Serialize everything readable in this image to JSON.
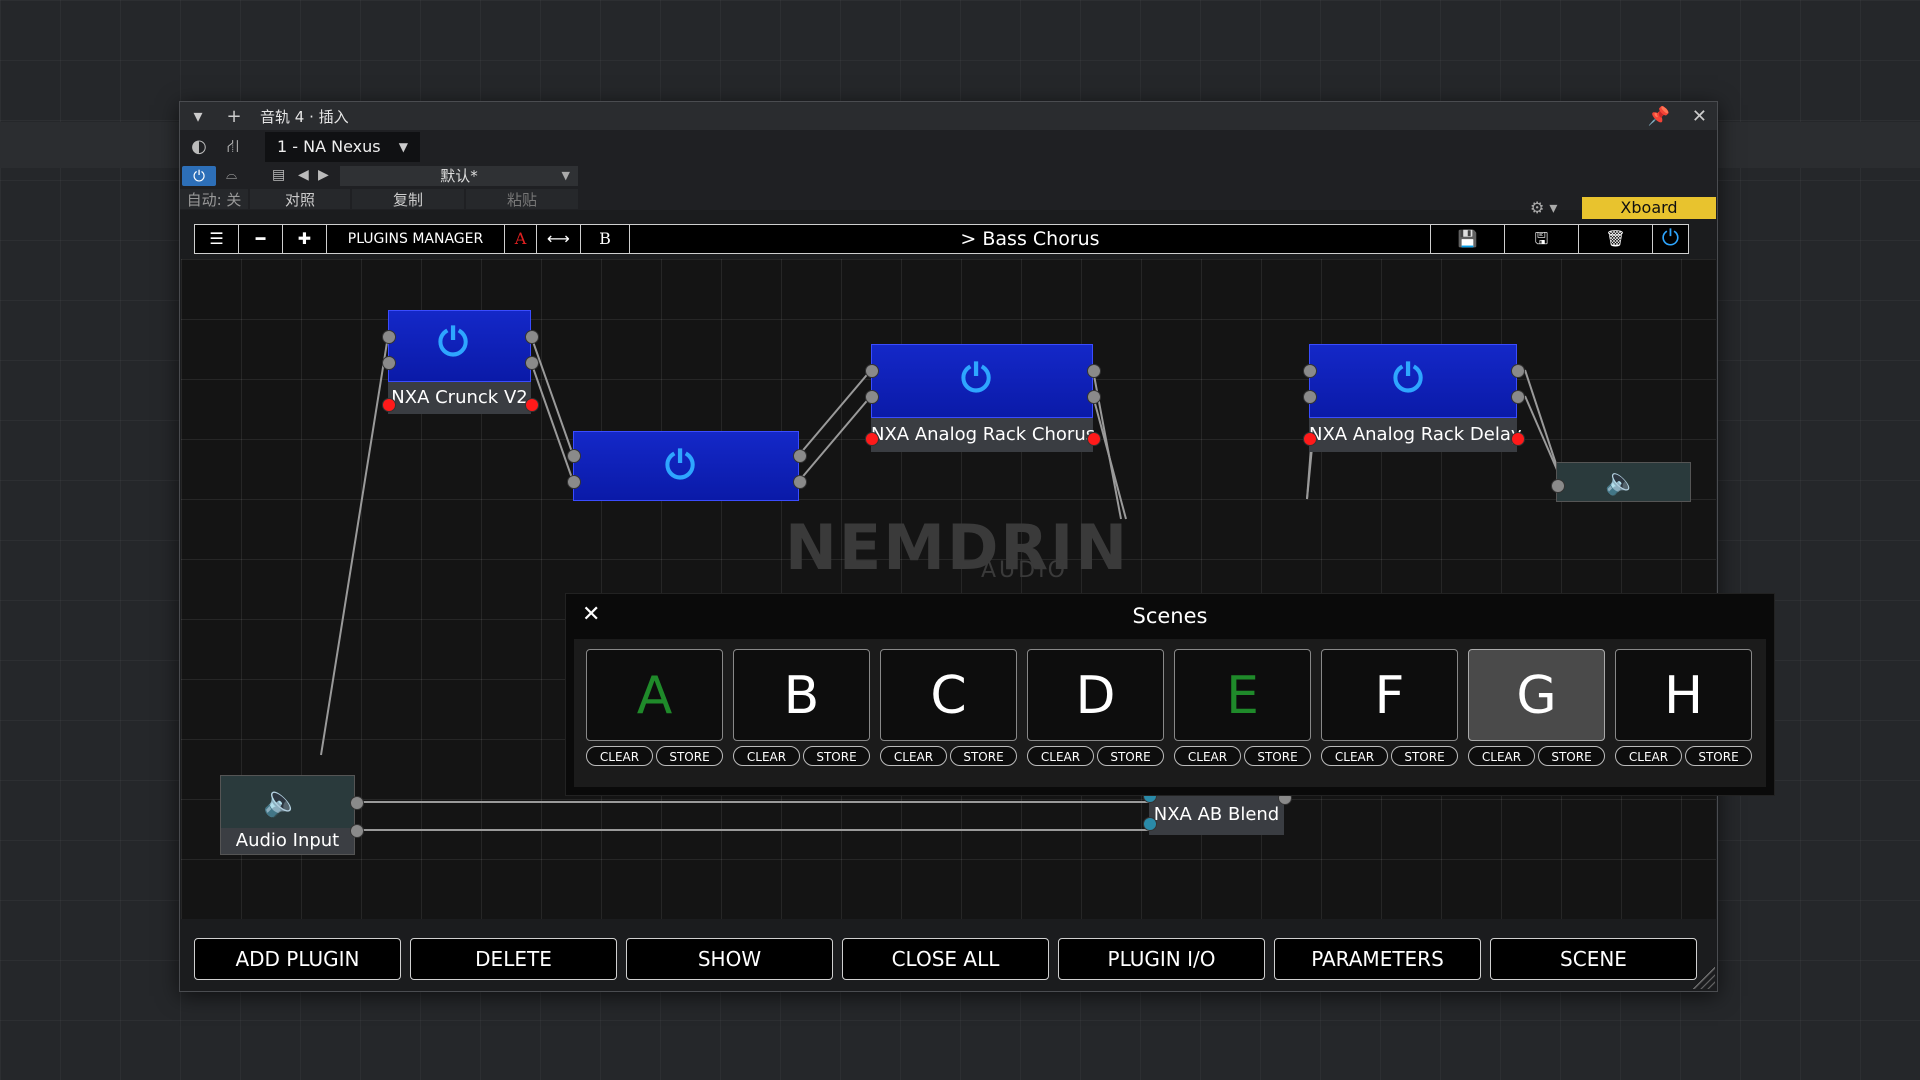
{
  "window": {
    "title": "音轨 4 · 插入",
    "plugin_selector": "1 - NA Nexus",
    "preset": "默认*",
    "auto_label": "自动: 关",
    "compare_label": "对照",
    "copy_label": "复制",
    "paste_label": "粘贴",
    "xboard_label": "Xboard"
  },
  "plugin_toolbar": {
    "plugins_manager": "PLUGINS MANAGER",
    "a_label": "A",
    "b_label": "B",
    "preset_title": "> Bass Chorus"
  },
  "nodes": {
    "crunck": "NXA Crunck V2",
    "chorus": "NXA Analog Rack Chorus",
    "delay": "NXA Analog Rack Delay",
    "ab_blend": "NXA AB Blend",
    "audio_input": "Audio Input"
  },
  "logo": {
    "main": "NEMDRIN",
    "sub": "AUDIO"
  },
  "scenes": {
    "title": "Scenes",
    "items": [
      {
        "letter": "A",
        "clear": "CLEAR",
        "store": "STORE"
      },
      {
        "letter": "B",
        "clear": "CLEAR",
        "store": "STORE"
      },
      {
        "letter": "C",
        "clear": "CLEAR",
        "store": "STORE"
      },
      {
        "letter": "D",
        "clear": "CLEAR",
        "store": "STORE"
      },
      {
        "letter": "E",
        "clear": "CLEAR",
        "store": "STORE"
      },
      {
        "letter": "F",
        "clear": "CLEAR",
        "store": "STORE"
      },
      {
        "letter": "G",
        "clear": "CLEAR",
        "store": "STORE"
      },
      {
        "letter": "H",
        "clear": "CLEAR",
        "store": "STORE"
      }
    ]
  },
  "bottom_buttons": {
    "add_plugin": "ADD PLUGIN",
    "delete": "DELETE",
    "show": "SHOW",
    "close_all": "CLOSE ALL",
    "plugin_io": "PLUGIN I/O",
    "parameters": "PARAMETERS",
    "scene": "SCENE"
  },
  "colors": {
    "node_blue": "#1428c8",
    "power_icon": "#2ea6ff",
    "xboard": "#e8c32e",
    "scene_green": "#1f8a2a"
  }
}
